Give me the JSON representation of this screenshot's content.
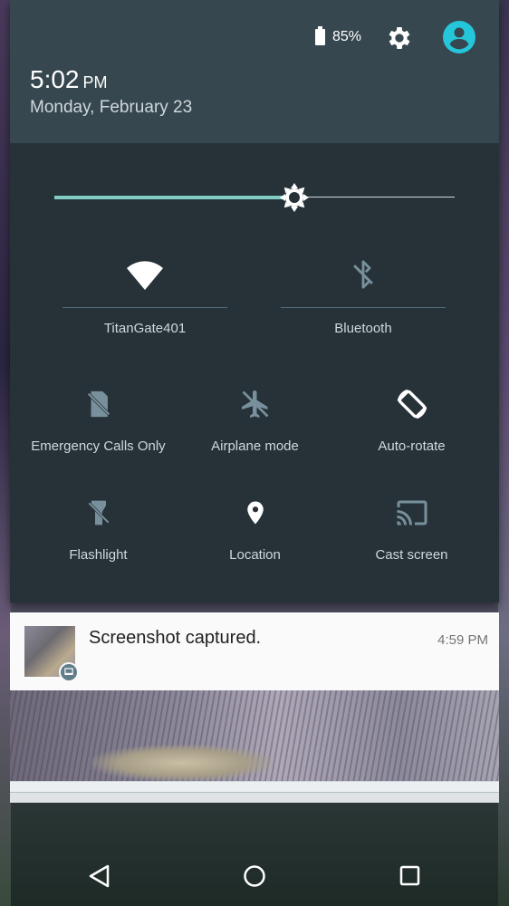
{
  "status": {
    "battery_pct": "85%",
    "battery_icon": "battery-icon",
    "settings_icon": "gear-icon",
    "user_icon": "account-icon"
  },
  "header": {
    "time": "5:02",
    "ampm": "PM",
    "date": "Monday, February 23"
  },
  "brightness": {
    "level": 0.6,
    "accent": "#80cbc4"
  },
  "tiles": {
    "wifi": {
      "label": "TitanGate401",
      "icon": "wifi-icon"
    },
    "bluetooth": {
      "label": "Bluetooth",
      "icon": "bluetooth-off-icon"
    },
    "sim": {
      "label": "Emergency Calls Only",
      "icon": "sim-card-off-icon"
    },
    "airplane": {
      "label": "Airplane mode",
      "icon": "airplane-off-icon"
    },
    "autorotate": {
      "label": "Auto-rotate",
      "icon": "rotate-icon"
    },
    "flashlight": {
      "label": "Flashlight",
      "icon": "flashlight-off-icon"
    },
    "location": {
      "label": "Location",
      "icon": "location-pin-icon"
    },
    "cast": {
      "label": "Cast screen",
      "icon": "cast-icon"
    }
  },
  "notification": {
    "title": "Screenshot captured.",
    "time": "4:59 PM"
  },
  "nav": {
    "back_icon": "back-triangle-icon",
    "home_icon": "home-circle-icon",
    "recents_icon": "recents-square-icon"
  },
  "colors": {
    "panel": "#263238",
    "header": "#37474f",
    "accent": "#80cbc4",
    "user_accent": "#26c6da"
  }
}
